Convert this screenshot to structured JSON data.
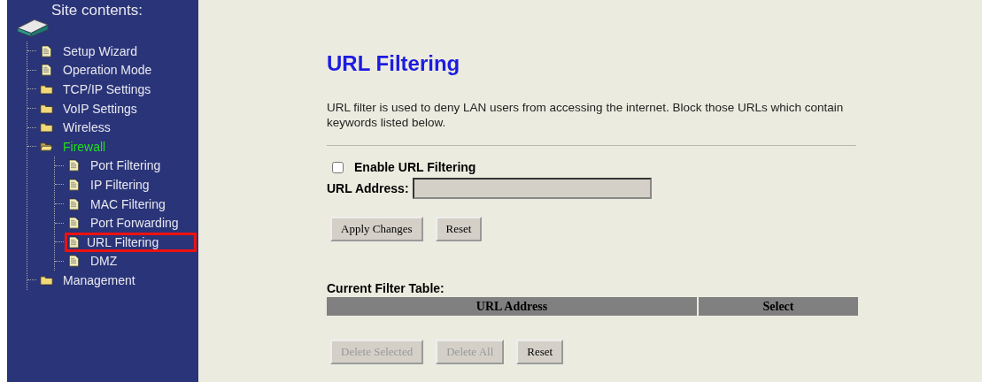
{
  "sidebar": {
    "title": "Site contents:",
    "items": [
      {
        "label": "Setup Wizard",
        "kind": "page",
        "active": false,
        "highlighted": false
      },
      {
        "label": "Operation Mode",
        "kind": "page",
        "active": false,
        "highlighted": false
      },
      {
        "label": "TCP/IP Settings",
        "kind": "folder",
        "expanded": false,
        "active": false,
        "highlighted": false
      },
      {
        "label": "VoIP Settings",
        "kind": "folder",
        "expanded": false,
        "active": false,
        "highlighted": false
      },
      {
        "label": "Wireless",
        "kind": "folder",
        "expanded": false,
        "active": false,
        "highlighted": false
      },
      {
        "label": "Firewall",
        "kind": "folder",
        "expanded": true,
        "active": true,
        "highlighted": false,
        "children": [
          {
            "label": "Port Filtering",
            "kind": "page",
            "active": false,
            "highlighted": false
          },
          {
            "label": "IP Filtering",
            "kind": "page",
            "active": false,
            "highlighted": false
          },
          {
            "label": "MAC Filtering",
            "kind": "page",
            "active": false,
            "highlighted": false
          },
          {
            "label": "Port Forwarding",
            "kind": "page",
            "active": false,
            "highlighted": false
          },
          {
            "label": "URL Filtering",
            "kind": "page",
            "active": false,
            "highlighted": true
          },
          {
            "label": "DMZ",
            "kind": "page",
            "active": false,
            "highlighted": false
          }
        ]
      },
      {
        "label": "Management",
        "kind": "folder",
        "expanded": false,
        "active": false,
        "highlighted": false
      }
    ]
  },
  "page": {
    "title": "URL Filtering",
    "description": "URL filter is used to deny LAN users from accessing the internet. Block those URLs which contain keywords listed below.",
    "enable": {
      "label": "Enable URL Filtering",
      "checked": false
    },
    "url_field": {
      "label": "URL Address:",
      "disabled": true
    },
    "buttons": [
      {
        "label": "Apply Changes",
        "disabled": false
      },
      {
        "label": "Reset",
        "disabled": false
      }
    ],
    "table": {
      "title": "Current Filter Table:",
      "columns": [
        "URL Address",
        "Select"
      ]
    },
    "table_buttons": [
      {
        "label": "Delete Selected",
        "disabled": true
      },
      {
        "label": "Delete All",
        "disabled": true
      },
      {
        "label": "Reset",
        "disabled": false
      }
    ]
  }
}
